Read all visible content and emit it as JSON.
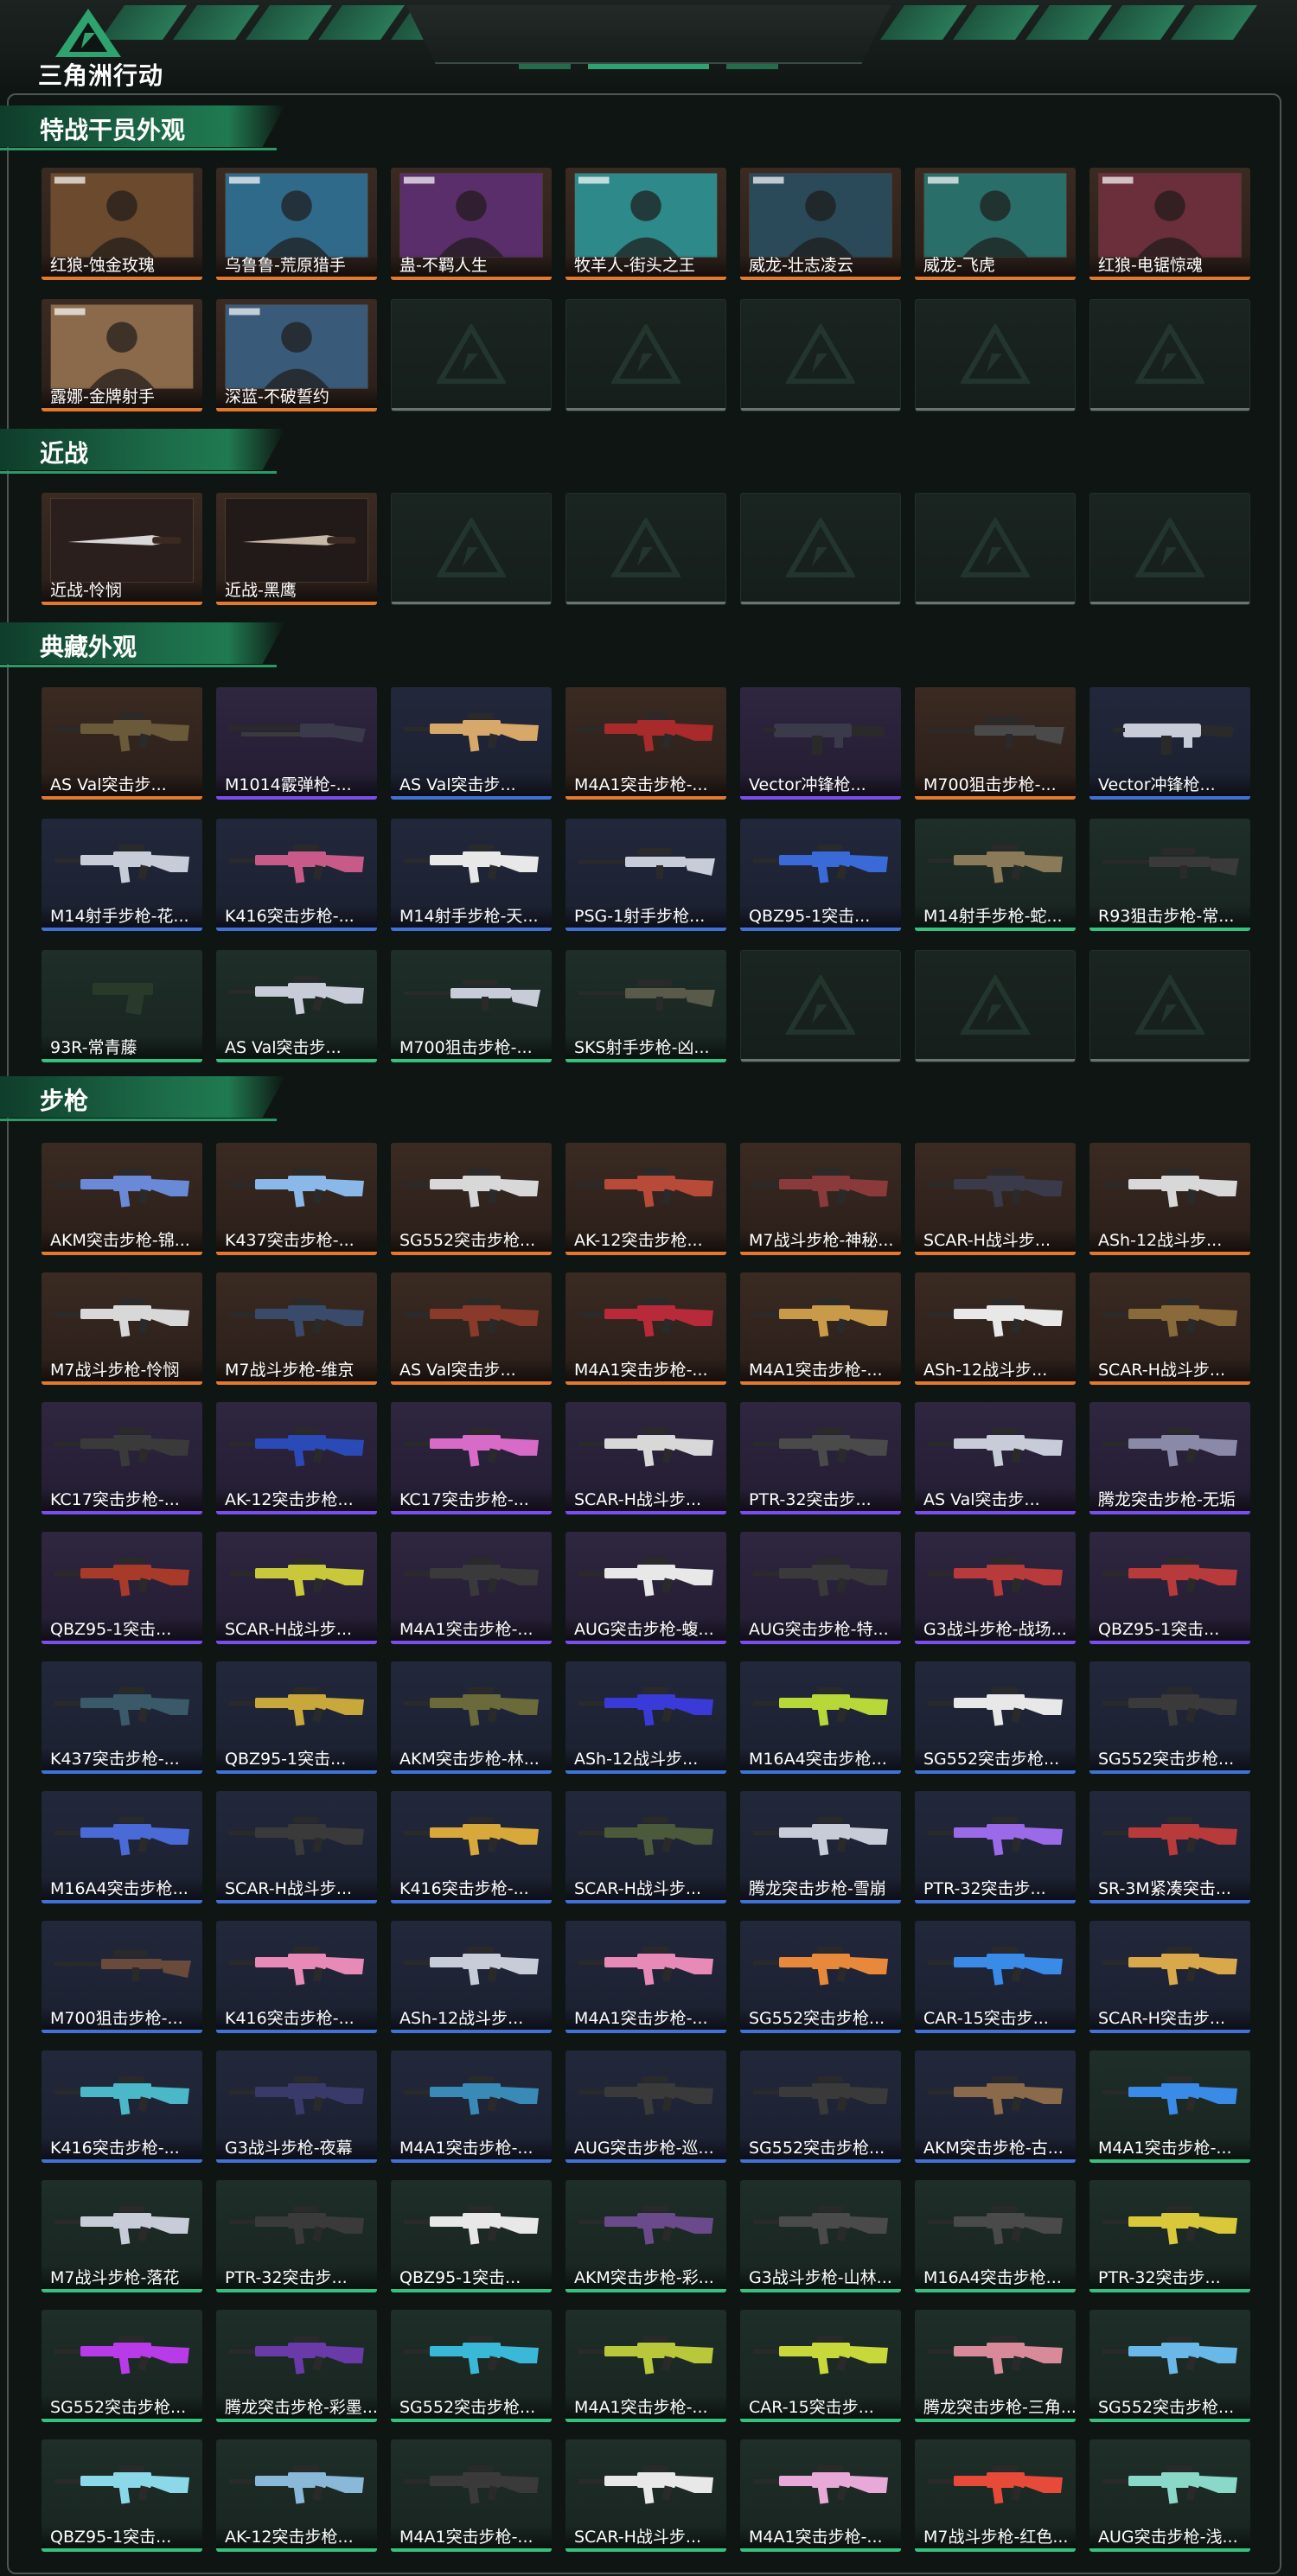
{
  "app": {
    "title": "三角洲行动"
  },
  "colors": {
    "orange": "#e3782e",
    "purple": "#7b4cf0",
    "blue": "#3f71d6",
    "green": "#34c27e",
    "accent": "#1f7a50"
  },
  "sections": [
    {
      "title": "特战干员外观",
      "items": [
        {
          "name": "红狼-蚀金玫瑰",
          "rarity": "orange",
          "kind": "photo",
          "icon": "operator-portrait-icon",
          "tint": "#6b4a2e"
        },
        {
          "name": "乌鲁鲁-荒原猎手",
          "rarity": "orange",
          "kind": "photo",
          "icon": "operator-portrait-icon",
          "tint": "#2f6a8a"
        },
        {
          "name": "蛊-不羁人生",
          "rarity": "orange",
          "kind": "photo",
          "icon": "operator-portrait-icon",
          "tint": "#5a2e6a"
        },
        {
          "name": "牧羊人-街头之王",
          "rarity": "orange",
          "kind": "photo",
          "icon": "operator-portrait-icon",
          "tint": "#2e8a8a"
        },
        {
          "name": "威龙-壮志凌云",
          "rarity": "orange",
          "kind": "photo",
          "icon": "operator-portrait-icon",
          "tint": "#2a4a5a"
        },
        {
          "name": "威龙-飞虎",
          "rarity": "orange",
          "kind": "photo",
          "icon": "operator-portrait-icon",
          "tint": "#2a6e6a"
        },
        {
          "name": "红狼-电锯惊魂",
          "rarity": "orange",
          "kind": "photo",
          "icon": "operator-portrait-icon",
          "tint": "#6a2f3a"
        },
        {
          "name": "露娜-金牌射手",
          "rarity": "orange",
          "kind": "photo",
          "icon": "operator-portrait-icon",
          "tint": "#8a6a4a"
        },
        {
          "name": "深蓝-不破誓约",
          "rarity": "orange",
          "kind": "photo",
          "icon": "operator-portrait-icon",
          "tint": "#3a5a7a"
        },
        {
          "name": "",
          "rarity": "empty"
        },
        {
          "name": "",
          "rarity": "empty"
        },
        {
          "name": "",
          "rarity": "empty"
        },
        {
          "name": "",
          "rarity": "empty"
        },
        {
          "name": "",
          "rarity": "empty"
        }
      ]
    },
    {
      "title": "近战",
      "items": [
        {
          "name": "近战-怜悯",
          "rarity": "orange",
          "kind": "photo",
          "icon": "knife-icon",
          "tint": "#2a1f1c"
        },
        {
          "name": "近战-黑鹰",
          "rarity": "orange",
          "kind": "photo",
          "icon": "knife-icon",
          "tint": "#221a18"
        },
        {
          "name": "",
          "rarity": "empty"
        },
        {
          "name": "",
          "rarity": "empty"
        },
        {
          "name": "",
          "rarity": "empty"
        },
        {
          "name": "",
          "rarity": "empty"
        },
        {
          "name": "",
          "rarity": "empty"
        }
      ]
    },
    {
      "title": "典藏外观",
      "items": [
        {
          "name": "AS Val突击步...",
          "rarity": "orange",
          "icon": "rifle-icon",
          "tint": "#6a5a3a"
        },
        {
          "name": "M1014霰弹枪-...",
          "rarity": "purple",
          "icon": "shotgun-icon",
          "tint": "#3a3a4a"
        },
        {
          "name": "AS Val突击步...",
          "rarity": "blue",
          "icon": "rifle-icon",
          "tint": "#d8a86a"
        },
        {
          "name": "M4A1突击步枪-...",
          "rarity": "orange",
          "icon": "rifle-icon",
          "tint": "#a82a2a"
        },
        {
          "name": "Vector冲锋枪...",
          "rarity": "purple",
          "icon": "smg-icon",
          "tint": "#3a3a4a"
        },
        {
          "name": "M700狙击步枪-...",
          "rarity": "orange",
          "icon": "sniper-icon",
          "tint": "#4a4a4a"
        },
        {
          "name": "Vector冲锋枪...",
          "rarity": "blue",
          "icon": "smg-icon",
          "tint": "#c8ccd8"
        },
        {
          "name": "M14射手步枪-花...",
          "rarity": "blue",
          "icon": "rifle-icon",
          "tint": "#c8ccd8"
        },
        {
          "name": "K416突击步枪-...",
          "rarity": "blue",
          "icon": "rifle-icon",
          "tint": "#c85a8a"
        },
        {
          "name": "M14射手步枪-天...",
          "rarity": "blue",
          "icon": "rifle-icon",
          "tint": "#e8e8e8"
        },
        {
          "name": "PSG-1射手步枪...",
          "rarity": "blue",
          "icon": "sniper-icon",
          "tint": "#c8ccd8"
        },
        {
          "name": "QBZ95-1突击...",
          "rarity": "blue",
          "icon": "rifle-icon",
          "tint": "#3a6ad8"
        },
        {
          "name": "M14射手步枪-蛇...",
          "rarity": "green",
          "icon": "rifle-icon",
          "tint": "#8a7a5a"
        },
        {
          "name": "R93狙击步枪-常...",
          "rarity": "green",
          "icon": "sniper-icon",
          "tint": "#3a3a3a"
        },
        {
          "name": "93R-常青藤",
          "rarity": "green",
          "icon": "pistol-icon",
          "tint": "#2a3a2a"
        },
        {
          "name": "AS Val突击步...",
          "rarity": "green",
          "icon": "rifle-icon",
          "tint": "#c8ccd8"
        },
        {
          "name": "M700狙击步枪-...",
          "rarity": "green",
          "icon": "sniper-icon",
          "tint": "#c8ccd8"
        },
        {
          "name": "SKS射手步枪-凶...",
          "rarity": "green",
          "icon": "sniper-icon",
          "tint": "#5a5a4a"
        },
        {
          "name": "",
          "rarity": "empty"
        },
        {
          "name": "",
          "rarity": "empty"
        },
        {
          "name": "",
          "rarity": "empty"
        }
      ]
    },
    {
      "title": "步枪",
      "items": [
        {
          "name": "AKM突击步枪-锦...",
          "rarity": "orange",
          "icon": "rifle-icon",
          "tint": "#6a8ad8"
        },
        {
          "name": "K437突击步枪-...",
          "rarity": "orange",
          "icon": "rifle-icon",
          "tint": "#8ab8e8"
        },
        {
          "name": "SG552突击步枪...",
          "rarity": "orange",
          "icon": "rifle-icon",
          "tint": "#d8d8d8"
        },
        {
          "name": "AK-12突击步枪...",
          "rarity": "orange",
          "icon": "rifle-icon",
          "tint": "#b84a3a"
        },
        {
          "name": "M7战斗步枪-神秘...",
          "rarity": "orange",
          "icon": "rifle-icon",
          "tint": "#8a3a3a"
        },
        {
          "name": "SCAR-H战斗步...",
          "rarity": "orange",
          "icon": "rifle-icon",
          "tint": "#3a3a4a"
        },
        {
          "name": "ASh-12战斗步...",
          "rarity": "orange",
          "icon": "rifle-icon",
          "tint": "#d8d8d8"
        },
        {
          "name": "M7战斗步枪-怜悯",
          "rarity": "orange",
          "icon": "rifle-icon",
          "tint": "#d8d8d8"
        },
        {
          "name": "M7战斗步枪-维京",
          "rarity": "orange",
          "icon": "rifle-icon",
          "tint": "#3a4a6a"
        },
        {
          "name": "AS Val突击步...",
          "rarity": "orange",
          "icon": "rifle-icon",
          "tint": "#8a3a2a"
        },
        {
          "name": "M4A1突击步枪-...",
          "rarity": "orange",
          "icon": "rifle-icon",
          "tint": "#b82a3a"
        },
        {
          "name": "M4A1突击步枪-...",
          "rarity": "orange",
          "icon": "rifle-icon",
          "tint": "#c89a4a"
        },
        {
          "name": "ASh-12战斗步...",
          "rarity": "orange",
          "icon": "rifle-icon",
          "tint": "#e8e8e8"
        },
        {
          "name": "SCAR-H战斗步...",
          "rarity": "orange",
          "icon": "rifle-icon",
          "tint": "#8a6a3a"
        },
        {
          "name": "KC17突击步枪-...",
          "rarity": "purple",
          "icon": "rifle-icon",
          "tint": "#3a3a3a"
        },
        {
          "name": "AK-12突击步枪...",
          "rarity": "purple",
          "icon": "rifle-icon",
          "tint": "#2a4ab8"
        },
        {
          "name": "KC17突击步枪-...",
          "rarity": "purple",
          "icon": "rifle-icon",
          "tint": "#d86ac8"
        },
        {
          "name": "SCAR-H战斗步...",
          "rarity": "purple",
          "icon": "rifle-icon",
          "tint": "#d8d8d8"
        },
        {
          "name": "PTR-32突击步...",
          "rarity": "purple",
          "icon": "rifle-icon",
          "tint": "#4a4a4a"
        },
        {
          "name": "AS Val突击步...",
          "rarity": "purple",
          "icon": "rifle-icon",
          "tint": "#c8ccd8"
        },
        {
          "name": "腾龙突击步枪-无垢",
          "rarity": "purple",
          "icon": "rifle-icon",
          "tint": "#8a8aa8"
        },
        {
          "name": "QBZ95-1突击...",
          "rarity": "purple",
          "icon": "rifle-icon",
          "tint": "#a83a2a"
        },
        {
          "name": "SCAR-H战斗步...",
          "rarity": "purple",
          "icon": "rifle-icon",
          "tint": "#c8c83a"
        },
        {
          "name": "M4A1突击步枪-...",
          "rarity": "purple",
          "icon": "rifle-icon",
          "tint": "#3a3a3a"
        },
        {
          "name": "AUG突击步枪-蝮...",
          "rarity": "purple",
          "icon": "rifle-icon",
          "tint": "#e8e8e8"
        },
        {
          "name": "AUG突击步枪-特...",
          "rarity": "purple",
          "icon": "rifle-icon",
          "tint": "#3a3a3a"
        },
        {
          "name": "G3战斗步枪-战场...",
          "rarity": "purple",
          "icon": "rifle-icon",
          "tint": "#b83a3a"
        },
        {
          "name": "QBZ95-1突击...",
          "rarity": "purple",
          "icon": "rifle-icon",
          "tint": "#b83a3a"
        },
        {
          "name": "K437突击步枪-...",
          "rarity": "blue",
          "icon": "rifle-icon",
          "tint": "#3a5a6a"
        },
        {
          "name": "QBZ95-1突击...",
          "rarity": "blue",
          "icon": "rifle-icon",
          "tint": "#c8a83a"
        },
        {
          "name": "AKM突击步枪-林...",
          "rarity": "blue",
          "icon": "rifle-icon",
          "tint": "#6a6a3a"
        },
        {
          "name": "ASh-12战斗步...",
          "rarity": "blue",
          "icon": "rifle-icon",
          "tint": "#3a3ad8"
        },
        {
          "name": "M16A4突击步枪...",
          "rarity": "blue",
          "icon": "rifle-icon",
          "tint": "#b8d83a"
        },
        {
          "name": "SG552突击步枪...",
          "rarity": "blue",
          "icon": "rifle-icon",
          "tint": "#e8e8e8"
        },
        {
          "name": "SG552突击步枪...",
          "rarity": "blue",
          "icon": "rifle-icon",
          "tint": "#3a3a3a"
        },
        {
          "name": "M16A4突击步枪...",
          "rarity": "blue",
          "icon": "rifle-icon",
          "tint": "#4a6ad8"
        },
        {
          "name": "SCAR-H战斗步...",
          "rarity": "blue",
          "icon": "rifle-icon",
          "tint": "#3a3a3a"
        },
        {
          "name": "K416突击步枪-...",
          "rarity": "blue",
          "icon": "rifle-icon",
          "tint": "#d8a83a"
        },
        {
          "name": "SCAR-H战斗步...",
          "rarity": "blue",
          "icon": "rifle-icon",
          "tint": "#4a5a3a"
        },
        {
          "name": "腾龙突击步枪-雪崩",
          "rarity": "blue",
          "icon": "rifle-icon",
          "tint": "#c8ccd8"
        },
        {
          "name": "PTR-32突击步...",
          "rarity": "blue",
          "icon": "rifle-icon",
          "tint": "#9a6ae8"
        },
        {
          "name": "SR-3M紧凑突击...",
          "rarity": "blue",
          "icon": "rifle-icon",
          "tint": "#b83a3a"
        },
        {
          "name": "M700狙击步枪-...",
          "rarity": "blue",
          "icon": "sniper-icon",
          "tint": "#6a4a3a"
        },
        {
          "name": "K416突击步枪-...",
          "rarity": "blue",
          "icon": "rifle-icon",
          "tint": "#e88ab8"
        },
        {
          "name": "ASh-12战斗步...",
          "rarity": "blue",
          "icon": "rifle-icon",
          "tint": "#c8ccd8"
        },
        {
          "name": "M4A1突击步枪-...",
          "rarity": "blue",
          "icon": "rifle-icon",
          "tint": "#e88ab8"
        },
        {
          "name": "SG552突击步枪...",
          "rarity": "blue",
          "icon": "rifle-icon",
          "tint": "#e8883a"
        },
        {
          "name": "CAR-15突击步...",
          "rarity": "blue",
          "icon": "rifle-icon",
          "tint": "#3a8ae8"
        },
        {
          "name": "SCAR-H突击步...",
          "rarity": "blue",
          "icon": "rifle-icon",
          "tint": "#d8a84a"
        },
        {
          "name": "K416突击步枪-...",
          "rarity": "blue",
          "icon": "rifle-icon",
          "tint": "#4ab8c8"
        },
        {
          "name": "G3战斗步枪-夜幕",
          "rarity": "blue",
          "icon": "rifle-icon",
          "tint": "#3a3a6a"
        },
        {
          "name": "M4A1突击步枪-...",
          "rarity": "blue",
          "icon": "rifle-icon",
          "tint": "#3a8ab8"
        },
        {
          "name": "AUG突击步枪-巡...",
          "rarity": "blue",
          "icon": "rifle-icon",
          "tint": "#3a3a3a"
        },
        {
          "name": "SG552突击步枪...",
          "rarity": "blue",
          "icon": "rifle-icon",
          "tint": "#3a3a3a"
        },
        {
          "name": "AKM突击步枪-古...",
          "rarity": "blue",
          "icon": "rifle-icon",
          "tint": "#8a6a4a"
        },
        {
          "name": "M4A1突击步枪-...",
          "rarity": "green",
          "icon": "rifle-icon",
          "tint": "#3a8ae8"
        },
        {
          "name": "M7战斗步枪-落花",
          "rarity": "green",
          "icon": "rifle-icon",
          "tint": "#c8ccd8"
        },
        {
          "name": "PTR-32突击步...",
          "rarity": "green",
          "icon": "rifle-icon",
          "tint": "#3a3a3a"
        },
        {
          "name": "QBZ95-1突击...",
          "rarity": "green",
          "icon": "rifle-icon",
          "tint": "#e8e8e8"
        },
        {
          "name": "AKM突击步枪-彩...",
          "rarity": "green",
          "icon": "rifle-icon",
          "tint": "#6a4a8a"
        },
        {
          "name": "G3战斗步枪-山林...",
          "rarity": "green",
          "icon": "rifle-icon",
          "tint": "#4a4a4a"
        },
        {
          "name": "M16A4突击步枪...",
          "rarity": "green",
          "icon": "rifle-icon",
          "tint": "#4a4a4a"
        },
        {
          "name": "PTR-32突击步...",
          "rarity": "green",
          "icon": "rifle-icon",
          "tint": "#d8c83a"
        },
        {
          "name": "SG552突击步枪...",
          "rarity": "green",
          "icon": "rifle-icon",
          "tint": "#b83ae8"
        },
        {
          "name": "腾龙突击步枪-彩墨...",
          "rarity": "green",
          "icon": "rifle-icon",
          "tint": "#6a3aa8"
        },
        {
          "name": "SG552突击步枪...",
          "rarity": "green",
          "icon": "rifle-icon",
          "tint": "#3ab8d8"
        },
        {
          "name": "M4A1突击步枪-...",
          "rarity": "green",
          "icon": "rifle-icon",
          "tint": "#b8c83a"
        },
        {
          "name": "CAR-15突击步...",
          "rarity": "green",
          "icon": "rifle-icon",
          "tint": "#c8d83a"
        },
        {
          "name": "腾龙突击步枪-三角...",
          "rarity": "green",
          "icon": "rifle-icon",
          "tint": "#d88a9a"
        },
        {
          "name": "SG552突击步枪...",
          "rarity": "green",
          "icon": "rifle-icon",
          "tint": "#6ab8e8"
        },
        {
          "name": "QBZ95-1突击...",
          "rarity": "green",
          "icon": "rifle-icon",
          "tint": "#8ad8e8"
        },
        {
          "name": "AK-12突击步枪...",
          "rarity": "green",
          "icon": "rifle-icon",
          "tint": "#8ab8d8"
        },
        {
          "name": "M4A1突击步枪-...",
          "rarity": "green",
          "icon": "rifle-icon",
          "tint": "#3a3a3a"
        },
        {
          "name": "SCAR-H战斗步...",
          "rarity": "green",
          "icon": "rifle-icon",
          "tint": "#e8e8e8"
        },
        {
          "name": "M4A1突击步枪-...",
          "rarity": "green",
          "icon": "rifle-icon",
          "tint": "#e8a8d8"
        },
        {
          "name": "M7战斗步枪-红色...",
          "rarity": "green",
          "icon": "rifle-icon",
          "tint": "#e84a3a"
        },
        {
          "name": "AUG突击步枪-浅...",
          "rarity": "green",
          "icon": "rifle-icon",
          "tint": "#8ad8c8"
        }
      ]
    }
  ]
}
